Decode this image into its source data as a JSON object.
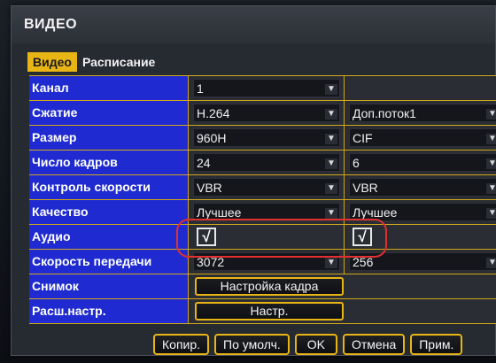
{
  "window": {
    "title": "ВИДЕО"
  },
  "tabs": [
    {
      "label": "Видео",
      "active": true
    },
    {
      "label": "Расписание",
      "active": false
    }
  ],
  "rows": {
    "channel": {
      "label": "Канал",
      "main": "1",
      "sub": ""
    },
    "compression": {
      "label": "Сжатие",
      "main": "H.264",
      "sub": "Доп.поток1"
    },
    "size": {
      "label": "Размер",
      "main": "960H",
      "sub": "CIF"
    },
    "framerate": {
      "label": "Число кадров",
      "main": "24",
      "sub": "6"
    },
    "bitrate_control": {
      "label": "Контроль скорости",
      "main": "VBR",
      "sub": "VBR"
    },
    "quality": {
      "label": "Качество",
      "main": "Лучшее",
      "sub": "Лучшее"
    },
    "audio": {
      "label": "Аудио",
      "main_checked": "√",
      "sub_checked": "√"
    },
    "bitrate": {
      "label": "Скорость передачи",
      "main": "3072",
      "sub": "256"
    },
    "snapshot": {
      "label": "Снимок",
      "button": "Настройка кадра"
    },
    "advanced": {
      "label": "Расш.настр.",
      "button": "Настр."
    }
  },
  "footer": {
    "copy": "Копир.",
    "default": "По умолч.",
    "ok": "OK",
    "cancel": "Отмена",
    "apply": "Прим."
  },
  "icons": {
    "dropdown": "▼",
    "checkbox": "checkmark-icon"
  },
  "colors": {
    "label_bg": "#1f2bd1",
    "accent": "#e8b515",
    "annotation": "#e03030"
  }
}
